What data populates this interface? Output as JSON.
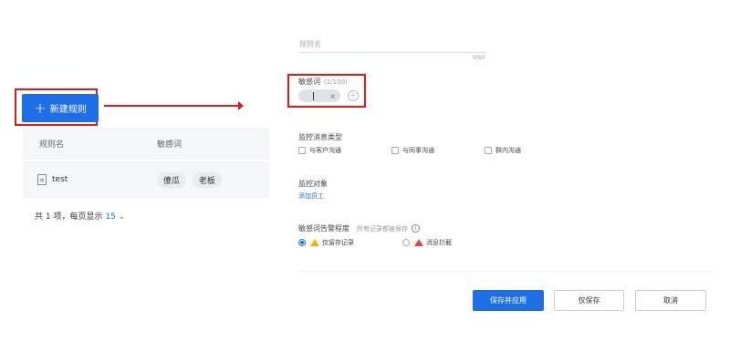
{
  "left": {
    "new_rule_label": "新建规则",
    "table": {
      "headers": [
        "规则名",
        "敏感词"
      ],
      "rows": [
        {
          "name": "test",
          "words": [
            "傻瓜",
            "老板"
          ]
        }
      ]
    },
    "pager": {
      "prefix": "共 1 项，每页显示",
      "page_size": "15"
    }
  },
  "form": {
    "rule_name_placeholder": "规则名",
    "rule_name_count": "0/50",
    "sensitive_label": "敏感词",
    "sensitive_count": "(1/100)",
    "message_type_label": "监控消息类型",
    "message_types": [
      "与客户沟通",
      "与同事沟通",
      "群内沟通"
    ],
    "target_label": "监控对象",
    "add_staff": "添加员工",
    "level_label": "敏感词告警程度",
    "level_hint": "所有记录都被保存",
    "level_options": [
      "仅留存记录",
      "消息拦截"
    ],
    "buttons": {
      "save_apply": "保存并应用",
      "save_only": "仅保存",
      "cancel": "取消"
    }
  },
  "colors": {
    "primary": "#1e6fe6",
    "highlight": "#e01a1a"
  }
}
